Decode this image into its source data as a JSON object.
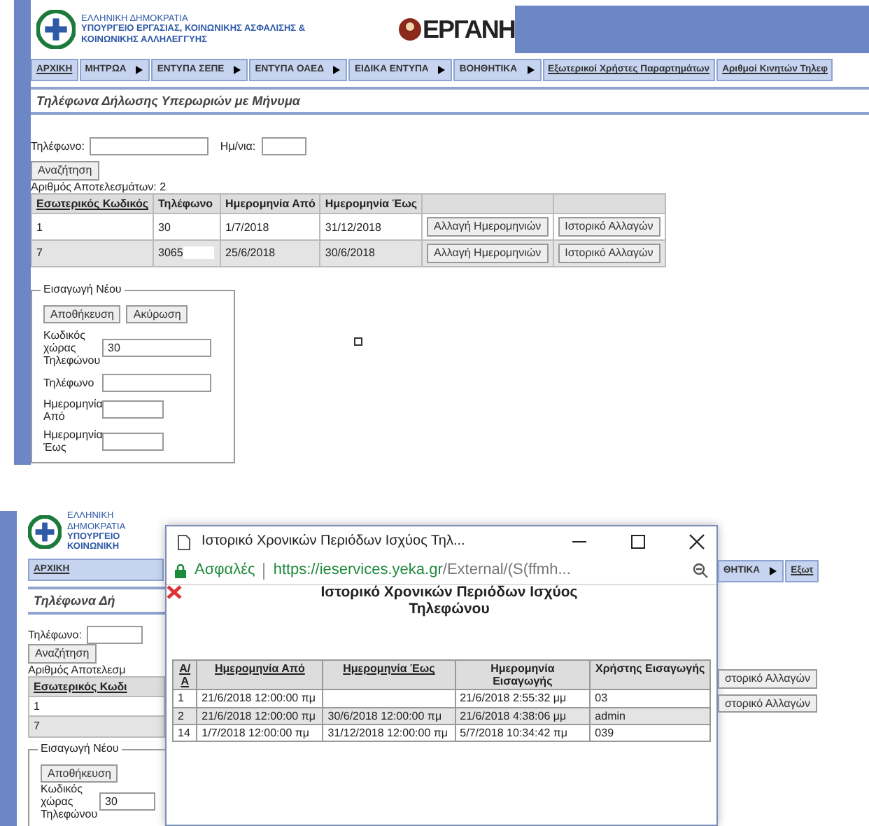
{
  "screens": [
    {
      "header": {
        "ministry_lines": [
          "ΕΛΛΗΝΙΚΗ ΔΗΜΟΚΡΑΤΙΑ",
          "ΥΠΟΥΡΓΕΙΟ ΕΡΓΑΣΙΑΣ, ΚΟΙΝΩΝΙΚΗΣ ΑΣΦΑΛΙΣΗΣ &",
          "ΚΟΙΝΩΝΙΚΗΣ ΑΛΛΗΛΕΓΓΥΗΣ"
        ],
        "logo_text": "ΕΡΓΑΝΗ"
      },
      "menu": [
        {
          "label": "ΑΡΧΙΚΗ",
          "kind": "link"
        },
        {
          "label": "ΜΗΤΡΩΑ",
          "kind": "dropdown"
        },
        {
          "label": "ΕΝΤΥΠΑ ΣΕΠΕ",
          "kind": "dropdown"
        },
        {
          "label": "ΕΝΤΥΠΑ ΟΑΕΔ",
          "kind": "dropdown"
        },
        {
          "label": "ΕΙΔΙΚΑ ΕΝΤΥΠΑ",
          "kind": "dropdown"
        },
        {
          "label": "ΒΟΗΘΗΤΙΚΑ",
          "kind": "dropdown"
        },
        {
          "label": "Εξωτερικοί Χρήστες Παραρτημάτων",
          "kind": "link"
        },
        {
          "label": "Αριθμοί Κινητών Τηλεφ",
          "kind": "link"
        }
      ],
      "page_title": "Τηλέφωνα Δήλωσης Υπερωριών με Μήνυμα",
      "search": {
        "phone_label": "Τηλέφωνο:",
        "date_label": "Ημ/νια:",
        "button": "Αναζήτηση"
      },
      "results_count": "Αριθμός Αποτελεσμάτων: 2",
      "table": {
        "columns": [
          {
            "label": "Εσωτερικός Κωδικός",
            "sortable": true
          },
          {
            "label": "Τηλέφωνο",
            "sortable": false
          },
          {
            "label": "Ημερομηνία Από",
            "sortable": false
          },
          {
            "label": "Ημερομηνία Έως",
            "sortable": false
          }
        ],
        "rows": [
          {
            "cells": [
              "1",
              "30",
              "1/7/2018",
              "31/12/2018"
            ],
            "buttons": [
              "Αλλαγή Ημερομηνιών",
              "Ιστορικό Αλλαγών"
            ],
            "redacted": false
          },
          {
            "cells": [
              "7",
              "3065",
              "25/6/2018",
              "30/6/2018"
            ],
            "buttons": [
              "Αλλαγή Ημερομηνιών",
              "Ιστορικό Αλλαγών"
            ],
            "redacted": true
          }
        ]
      },
      "new_entry": {
        "legend": "Εισαγωγή Νέου",
        "buttons": [
          "Αποθήκευση",
          "Ακύρωση"
        ],
        "fields": [
          {
            "label": "Κωδικός χώρας Τηλεφώνου",
            "value": "30",
            "kind": "text"
          },
          {
            "label": "Τηλέφωνο",
            "kind": "text"
          },
          {
            "label": "Ημερομηνία Από",
            "kind": "date"
          },
          {
            "label": "Ημερομηνία Έως",
            "kind": "date"
          }
        ]
      }
    },
    {
      "background_left": {
        "ministry_lines": [
          "ΕΛΛΗΝΙΚΗ ΔΗΜΟΚΡΑΤΙΑ",
          "ΥΠΟΥΡΓΕΙΟ",
          "ΚΟΙΝΩΝΙΚΗ"
        ],
        "menu_item": "ΑΡΧΙΚΗ",
        "page_title": "Τηλέφωνα Δή",
        "phone_label": "Τηλέφωνο:",
        "search_button": "Αναζήτηση",
        "results_count": "Αριθμός Αποτελεσμ",
        "table_header": "Εσωτερικός Κωδι",
        "row_ids": [
          "1",
          "7"
        ],
        "legend": "Εισαγωγή Νέου",
        "save_button": "Αποθήκευση",
        "field_label": "Κωδικός χώρας Τηλεφώνου",
        "field_value": "30"
      },
      "background_right": {
        "menu": [
          {
            "label": "ΘΗΤΙΚΑ",
            "kind": "dropdown"
          },
          {
            "label": "Εξωτ",
            "kind": "link"
          }
        ],
        "row_buttons": [
          "στορικό Αλλαγών",
          "στορικό Αλλαγών"
        ]
      },
      "popup": {
        "title": "Ιστορικό Χρονικών Περιόδων Ισχύος Τηλ...",
        "secure_label": "Ασφαλές",
        "url_host": "https://ieservices.yeka.gr",
        "url_path": "/External/(S(ffmh...",
        "heading": "Ιστορικό Χρονικών Περιόδων Ισχύος Τηλεφώνου",
        "table": {
          "columns": [
            {
              "label": "Α/Α",
              "sortable": true
            },
            {
              "label": "Ημερομηνία Από",
              "sortable": true
            },
            {
              "label": "Ημερομηνία Έως",
              "sortable": true
            },
            {
              "label": "Ημερομηνία Εισαγωγής",
              "sortable": false
            },
            {
              "label": "Χρήστης Εισαγωγής",
              "sortable": false
            }
          ],
          "rows": [
            [
              "1",
              "21/6/2018 12:00:00 πμ",
              "",
              "21/6/2018 2:55:32 μμ",
              "03"
            ],
            [
              "2",
              "21/6/2018 12:00:00 πμ",
              "30/6/2018 12:00:00 πμ",
              "21/6/2018 4:38:06 μμ",
              "admin"
            ],
            [
              "14",
              "1/7/2018 12:00:00 πμ",
              "31/12/2018 12:00:00 πμ",
              "5/7/2018 10:34:42 πμ",
              "039"
            ]
          ]
        }
      }
    }
  ]
}
